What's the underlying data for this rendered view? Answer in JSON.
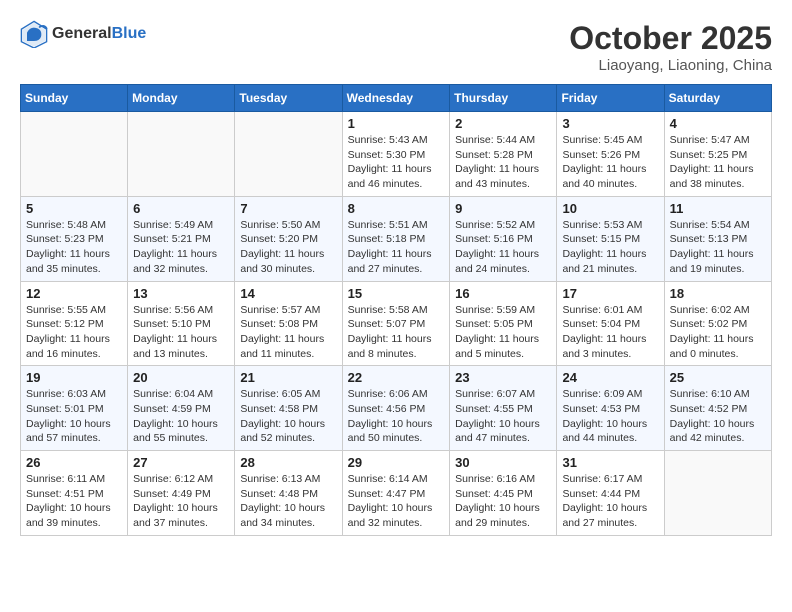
{
  "header": {
    "logo_line1": "General",
    "logo_line2": "Blue",
    "month": "October 2025",
    "location": "Liaoyang, Liaoning, China"
  },
  "days_of_week": [
    "Sunday",
    "Monday",
    "Tuesday",
    "Wednesday",
    "Thursday",
    "Friday",
    "Saturday"
  ],
  "weeks": [
    [
      {
        "day": "",
        "info": ""
      },
      {
        "day": "",
        "info": ""
      },
      {
        "day": "",
        "info": ""
      },
      {
        "day": "1",
        "info": "Sunrise: 5:43 AM\nSunset: 5:30 PM\nDaylight: 11 hours and 46 minutes."
      },
      {
        "day": "2",
        "info": "Sunrise: 5:44 AM\nSunset: 5:28 PM\nDaylight: 11 hours and 43 minutes."
      },
      {
        "day": "3",
        "info": "Sunrise: 5:45 AM\nSunset: 5:26 PM\nDaylight: 11 hours and 40 minutes."
      },
      {
        "day": "4",
        "info": "Sunrise: 5:47 AM\nSunset: 5:25 PM\nDaylight: 11 hours and 38 minutes."
      }
    ],
    [
      {
        "day": "5",
        "info": "Sunrise: 5:48 AM\nSunset: 5:23 PM\nDaylight: 11 hours and 35 minutes."
      },
      {
        "day": "6",
        "info": "Sunrise: 5:49 AM\nSunset: 5:21 PM\nDaylight: 11 hours and 32 minutes."
      },
      {
        "day": "7",
        "info": "Sunrise: 5:50 AM\nSunset: 5:20 PM\nDaylight: 11 hours and 30 minutes."
      },
      {
        "day": "8",
        "info": "Sunrise: 5:51 AM\nSunset: 5:18 PM\nDaylight: 11 hours and 27 minutes."
      },
      {
        "day": "9",
        "info": "Sunrise: 5:52 AM\nSunset: 5:16 PM\nDaylight: 11 hours and 24 minutes."
      },
      {
        "day": "10",
        "info": "Sunrise: 5:53 AM\nSunset: 5:15 PM\nDaylight: 11 hours and 21 minutes."
      },
      {
        "day": "11",
        "info": "Sunrise: 5:54 AM\nSunset: 5:13 PM\nDaylight: 11 hours and 19 minutes."
      }
    ],
    [
      {
        "day": "12",
        "info": "Sunrise: 5:55 AM\nSunset: 5:12 PM\nDaylight: 11 hours and 16 minutes."
      },
      {
        "day": "13",
        "info": "Sunrise: 5:56 AM\nSunset: 5:10 PM\nDaylight: 11 hours and 13 minutes."
      },
      {
        "day": "14",
        "info": "Sunrise: 5:57 AM\nSunset: 5:08 PM\nDaylight: 11 hours and 11 minutes."
      },
      {
        "day": "15",
        "info": "Sunrise: 5:58 AM\nSunset: 5:07 PM\nDaylight: 11 hours and 8 minutes."
      },
      {
        "day": "16",
        "info": "Sunrise: 5:59 AM\nSunset: 5:05 PM\nDaylight: 11 hours and 5 minutes."
      },
      {
        "day": "17",
        "info": "Sunrise: 6:01 AM\nSunset: 5:04 PM\nDaylight: 11 hours and 3 minutes."
      },
      {
        "day": "18",
        "info": "Sunrise: 6:02 AM\nSunset: 5:02 PM\nDaylight: 11 hours and 0 minutes."
      }
    ],
    [
      {
        "day": "19",
        "info": "Sunrise: 6:03 AM\nSunset: 5:01 PM\nDaylight: 10 hours and 57 minutes."
      },
      {
        "day": "20",
        "info": "Sunrise: 6:04 AM\nSunset: 4:59 PM\nDaylight: 10 hours and 55 minutes."
      },
      {
        "day": "21",
        "info": "Sunrise: 6:05 AM\nSunset: 4:58 PM\nDaylight: 10 hours and 52 minutes."
      },
      {
        "day": "22",
        "info": "Sunrise: 6:06 AM\nSunset: 4:56 PM\nDaylight: 10 hours and 50 minutes."
      },
      {
        "day": "23",
        "info": "Sunrise: 6:07 AM\nSunset: 4:55 PM\nDaylight: 10 hours and 47 minutes."
      },
      {
        "day": "24",
        "info": "Sunrise: 6:09 AM\nSunset: 4:53 PM\nDaylight: 10 hours and 44 minutes."
      },
      {
        "day": "25",
        "info": "Sunrise: 6:10 AM\nSunset: 4:52 PM\nDaylight: 10 hours and 42 minutes."
      }
    ],
    [
      {
        "day": "26",
        "info": "Sunrise: 6:11 AM\nSunset: 4:51 PM\nDaylight: 10 hours and 39 minutes."
      },
      {
        "day": "27",
        "info": "Sunrise: 6:12 AM\nSunset: 4:49 PM\nDaylight: 10 hours and 37 minutes."
      },
      {
        "day": "28",
        "info": "Sunrise: 6:13 AM\nSunset: 4:48 PM\nDaylight: 10 hours and 34 minutes."
      },
      {
        "day": "29",
        "info": "Sunrise: 6:14 AM\nSunset: 4:47 PM\nDaylight: 10 hours and 32 minutes."
      },
      {
        "day": "30",
        "info": "Sunrise: 6:16 AM\nSunset: 4:45 PM\nDaylight: 10 hours and 29 minutes."
      },
      {
        "day": "31",
        "info": "Sunrise: 6:17 AM\nSunset: 4:44 PM\nDaylight: 10 hours and 27 minutes."
      },
      {
        "day": "",
        "info": ""
      }
    ]
  ]
}
